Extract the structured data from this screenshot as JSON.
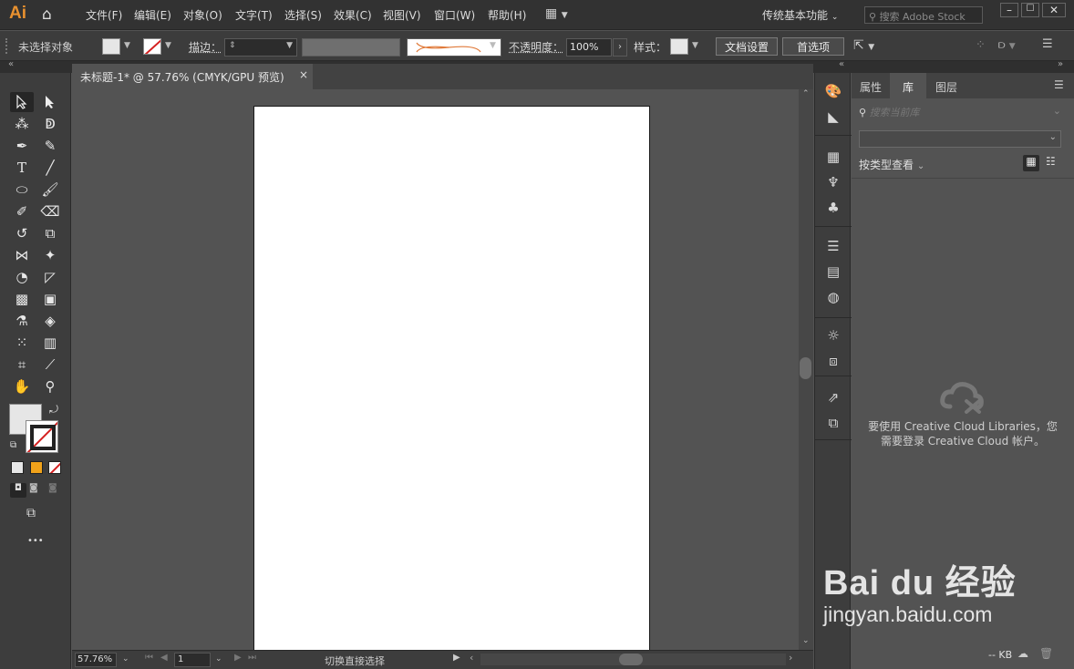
{
  "app": {
    "logo": "Ai",
    "workspace": "传统基本功能",
    "search_placeholder": "搜索 Adobe Stock"
  },
  "menu": [
    "文件(F)",
    "编辑(E)",
    "对象(O)",
    "文字(T)",
    "选择(S)",
    "效果(C)",
    "视图(V)",
    "窗口(W)",
    "帮助(H)"
  ],
  "control": {
    "no_selection": "未选择对象",
    "stroke_label": "描边：",
    "opacity_label": "不透明度：",
    "opacity_value": "100%",
    "style_label": "样式：",
    "doc_setup": "文档设置",
    "preferences": "首选项"
  },
  "document": {
    "tab_title": "未标题-1* @ 57.76% (CMYK/GPU 预览)",
    "close": "×"
  },
  "status": {
    "zoom": "57.76%",
    "artboard": "1",
    "tool_hint": "切换直接选择"
  },
  "panel": {
    "tabs": [
      "属性",
      "库",
      "图层"
    ],
    "search_placeholder": "搜索当前库",
    "view_by": "按类型查看",
    "cloud_line1": "要使用 Creative Cloud Libraries，您",
    "cloud_line2": "需要登录 Creative Cloud 帐户。",
    "size": "-- KB"
  },
  "toolbar": {
    "more": "•••"
  },
  "watermark": {
    "brand": "Bai du 经验",
    "url": "jingyan.baidu.com"
  },
  "colors": {
    "accent": "#e8912f",
    "bg": "#535353",
    "panel": "#3d3d3d"
  }
}
